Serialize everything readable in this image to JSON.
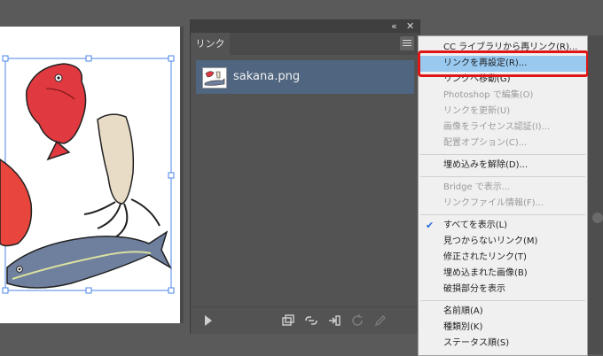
{
  "panel": {
    "tab_label": "リンク",
    "close_glyph": "✕",
    "collapse_glyph": "«",
    "link_item_name": "sakana.png"
  },
  "menu": {
    "items": [
      {
        "label": "CC ライブラリから再リンク(R)...",
        "disabled": false
      },
      {
        "label": "リンクを再設定(R)...",
        "disabled": false,
        "highlight": true
      },
      {
        "label": "リンクへ移動(G)",
        "disabled": false
      },
      {
        "label": "Photoshop で編集(O)",
        "disabled": true
      },
      {
        "label": "リンクを更新(U)",
        "disabled": true
      },
      {
        "label": "画像をライセンス認証(I)...",
        "disabled": true
      },
      {
        "label": "配置オプション(C)...",
        "disabled": true
      },
      {
        "label": "埋め込みを解除(D)...",
        "disabled": false
      },
      {
        "label": "Bridge で表示...",
        "disabled": true
      },
      {
        "label": "リンクファイル情報(F)...",
        "disabled": true
      },
      {
        "label": "すべてを表示(L)",
        "disabled": false,
        "checked": true
      },
      {
        "label": "見つからないリンク(M)",
        "disabled": false
      },
      {
        "label": "修正されたリンク(T)",
        "disabled": false
      },
      {
        "label": "埋め込まれた画像(B)",
        "disabled": false
      },
      {
        "label": "破損部分を表示",
        "disabled": false
      },
      {
        "label": "名前順(A)",
        "disabled": false
      },
      {
        "label": "種類別(K)",
        "disabled": false
      },
      {
        "label": "ステータス順(S)",
        "disabled": false
      }
    ],
    "check_glyph": "✔"
  },
  "colors": {
    "menu_highlight": "#99c9ef",
    "callout_red": "#e01515",
    "selected_row": "#4f6580"
  }
}
